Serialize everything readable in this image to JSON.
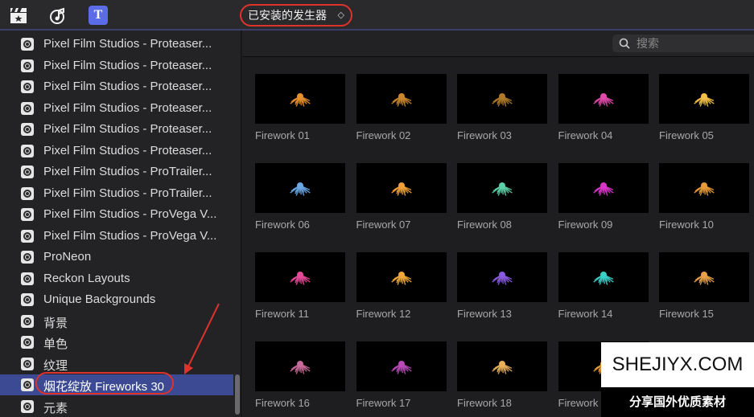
{
  "toolbar": {
    "icons": [
      "clapper-icon",
      "music-icon",
      "titles-icon"
    ],
    "titles_glyph": "T",
    "dropdown_label": "已安装的发生器",
    "dropdown_chevron": "⌃⌄"
  },
  "sidebar": {
    "items": [
      {
        "label": "Pixel Film Studios - Proteaser..."
      },
      {
        "label": "Pixel Film Studios - Proteaser..."
      },
      {
        "label": "Pixel Film Studios - Proteaser..."
      },
      {
        "label": "Pixel Film Studios - Proteaser..."
      },
      {
        "label": "Pixel Film Studios - Proteaser..."
      },
      {
        "label": "Pixel Film Studios - Proteaser..."
      },
      {
        "label": "Pixel Film Studios - ProTrailer..."
      },
      {
        "label": "Pixel Film Studios - ProTrailer..."
      },
      {
        "label": "Pixel Film Studios - ProVega V..."
      },
      {
        "label": "Pixel Film Studios - ProVega V..."
      },
      {
        "label": "ProNeon"
      },
      {
        "label": "Reckon Layouts"
      },
      {
        "label": "Unique Backgrounds"
      },
      {
        "label": "背景"
      },
      {
        "label": "单色"
      },
      {
        "label": "纹理"
      },
      {
        "label": "烟花绽放 Fireworks 30",
        "selected": true
      },
      {
        "label": "元素"
      }
    ]
  },
  "search": {
    "placeholder": "搜索"
  },
  "grid": {
    "items": [
      {
        "name": "Firework 01",
        "color": "#e8912a"
      },
      {
        "name": "Firework 02",
        "color": "#c9862e"
      },
      {
        "name": "Firework 03",
        "color": "#b07a2a"
      },
      {
        "name": "Firework 04",
        "color": "#e04aa8"
      },
      {
        "name": "Firework 05",
        "color": "#f2c04a"
      },
      {
        "name": "Firework 06",
        "color": "#6aa8e8"
      },
      {
        "name": "Firework 07",
        "color": "#f0a03a"
      },
      {
        "name": "Firework 08",
        "color": "#5ed0a8"
      },
      {
        "name": "Firework 09",
        "color": "#d838c8"
      },
      {
        "name": "Firework 10",
        "color": "#e89a3a"
      },
      {
        "name": "Firework 11",
        "color": "#e84a9a"
      },
      {
        "name": "Firework 12",
        "color": "#f0a83a"
      },
      {
        "name": "Firework 13",
        "color": "#8a5ae0"
      },
      {
        "name": "Firework 14",
        "color": "#3ad0c8"
      },
      {
        "name": "Firework 15",
        "color": "#e8a04a"
      },
      {
        "name": "Firework 16",
        "color": "#c86a9a"
      },
      {
        "name": "Firework 17",
        "color": "#b84ab8"
      },
      {
        "name": "Firework 18",
        "color": "#e8b05a"
      },
      {
        "name": "Firework 19",
        "color": "#e8a03a"
      }
    ]
  },
  "watermark": {
    "site": "SHEJIYX.COM",
    "tagline": "分享国外优质素材"
  }
}
